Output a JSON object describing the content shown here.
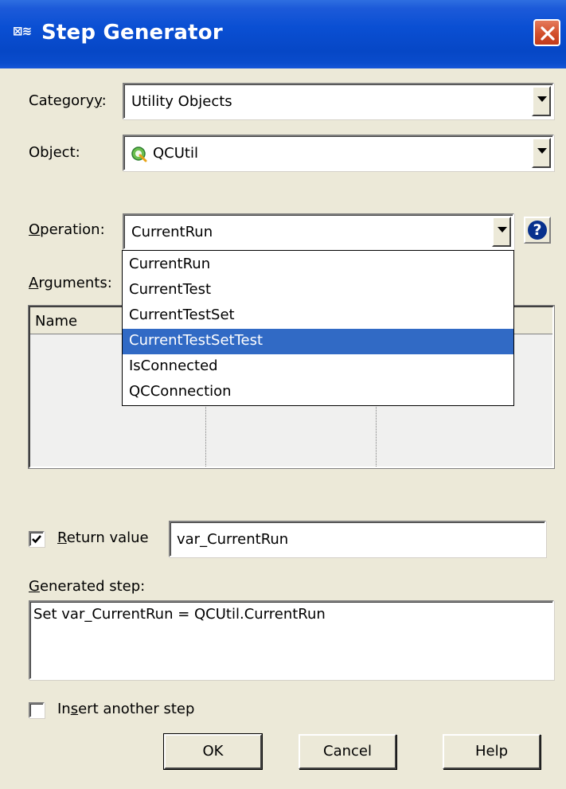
{
  "window": {
    "title": "Step Generator",
    "title_icon": "step-generator-icon",
    "close_icon": "close-icon"
  },
  "category": {
    "label_pre": "Category",
    "label_ul": "y",
    "label_post": ":",
    "value": "Utility Objects"
  },
  "object": {
    "label_pre": "Object",
    "label_post": ":",
    "value": "QCUtil",
    "icon": "qcutil-object-icon"
  },
  "operation": {
    "label_ul": "O",
    "label_post": "peration:",
    "value": "CurrentRun",
    "help_icon": "help-icon",
    "options": [
      "CurrentRun",
      "CurrentTest",
      "CurrentTestSet",
      "CurrentTestSetTest",
      "IsConnected",
      "QCConnection"
    ],
    "highlighted_index": 3
  },
  "arguments": {
    "label_ul": "A",
    "label_post": "rguments:",
    "columns": [
      "Name",
      "",
      ""
    ]
  },
  "return_value": {
    "checked": true,
    "label_ul": "R",
    "label_post": "eturn value",
    "value": "var_CurrentRun"
  },
  "generated_step": {
    "label_ul": "G",
    "label_post": "enerated step:",
    "value": "Set var_CurrentRun = QCUtil.CurrentRun"
  },
  "insert_another": {
    "checked": false,
    "label_pre": "In",
    "label_ul": "s",
    "label_post": "ert another step"
  },
  "buttons": {
    "ok": "OK",
    "cancel": "Cancel",
    "help": "Help"
  },
  "colors": {
    "titlebar": "#0a4fd3",
    "selection": "#316ac5",
    "face": "#ece9d8"
  }
}
